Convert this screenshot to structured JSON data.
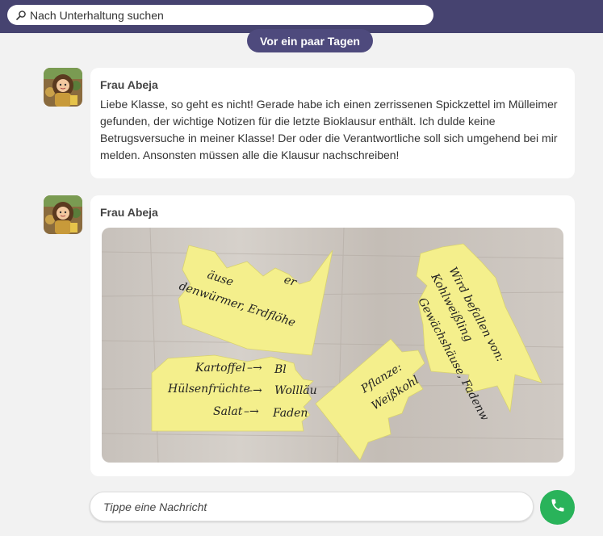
{
  "search": {
    "placeholder": "Nach Unterhaltung suchen",
    "icon": "search-icon"
  },
  "date_separator": "Vor ein paar Tagen",
  "messages": [
    {
      "sender": "Frau Abeja",
      "avatar": "teacher-avatar",
      "text": "Liebe Klasse, so geht es nicht! Gerade habe ich einen zerrissenen Spickzettel im Mülleimer gefunden, der wichtige Notizen für die letzte Bioklausur enthält. Ich dulde keine Betrugsversuche in meiner Klasse! Der oder die Verantwortliche soll sich umgehend bei mir melden. Ansonsten müssen alle die Klausur nachschreiben!"
    },
    {
      "sender": "Frau Abeja",
      "avatar": "teacher-avatar",
      "image": {
        "piece1_lines": [
          "äuse",
          "er",
          "denwürmer, Erdflöhe"
        ],
        "piece2_lines": [
          "Wird befallen von:",
          "Kohlweißling",
          "Gewächshäuse, Fadenw"
        ],
        "piece3_lines": [
          "Pflanze:",
          "Weißkohl"
        ],
        "piece4_lines": [
          "Kartoffel",
          "Bl",
          "Hülsenfrüchte",
          "Wollläu",
          "Salat",
          "Faden"
        ],
        "arrow": "–→"
      }
    }
  ],
  "composer": {
    "placeholder": "Tippe eine Nachricht"
  },
  "call_button": {
    "icon": "phone-icon"
  },
  "colors": {
    "topbar": "#464370",
    "pill": "#4e4a7d",
    "call": "#29b35a",
    "note": "#f4ef8c"
  }
}
